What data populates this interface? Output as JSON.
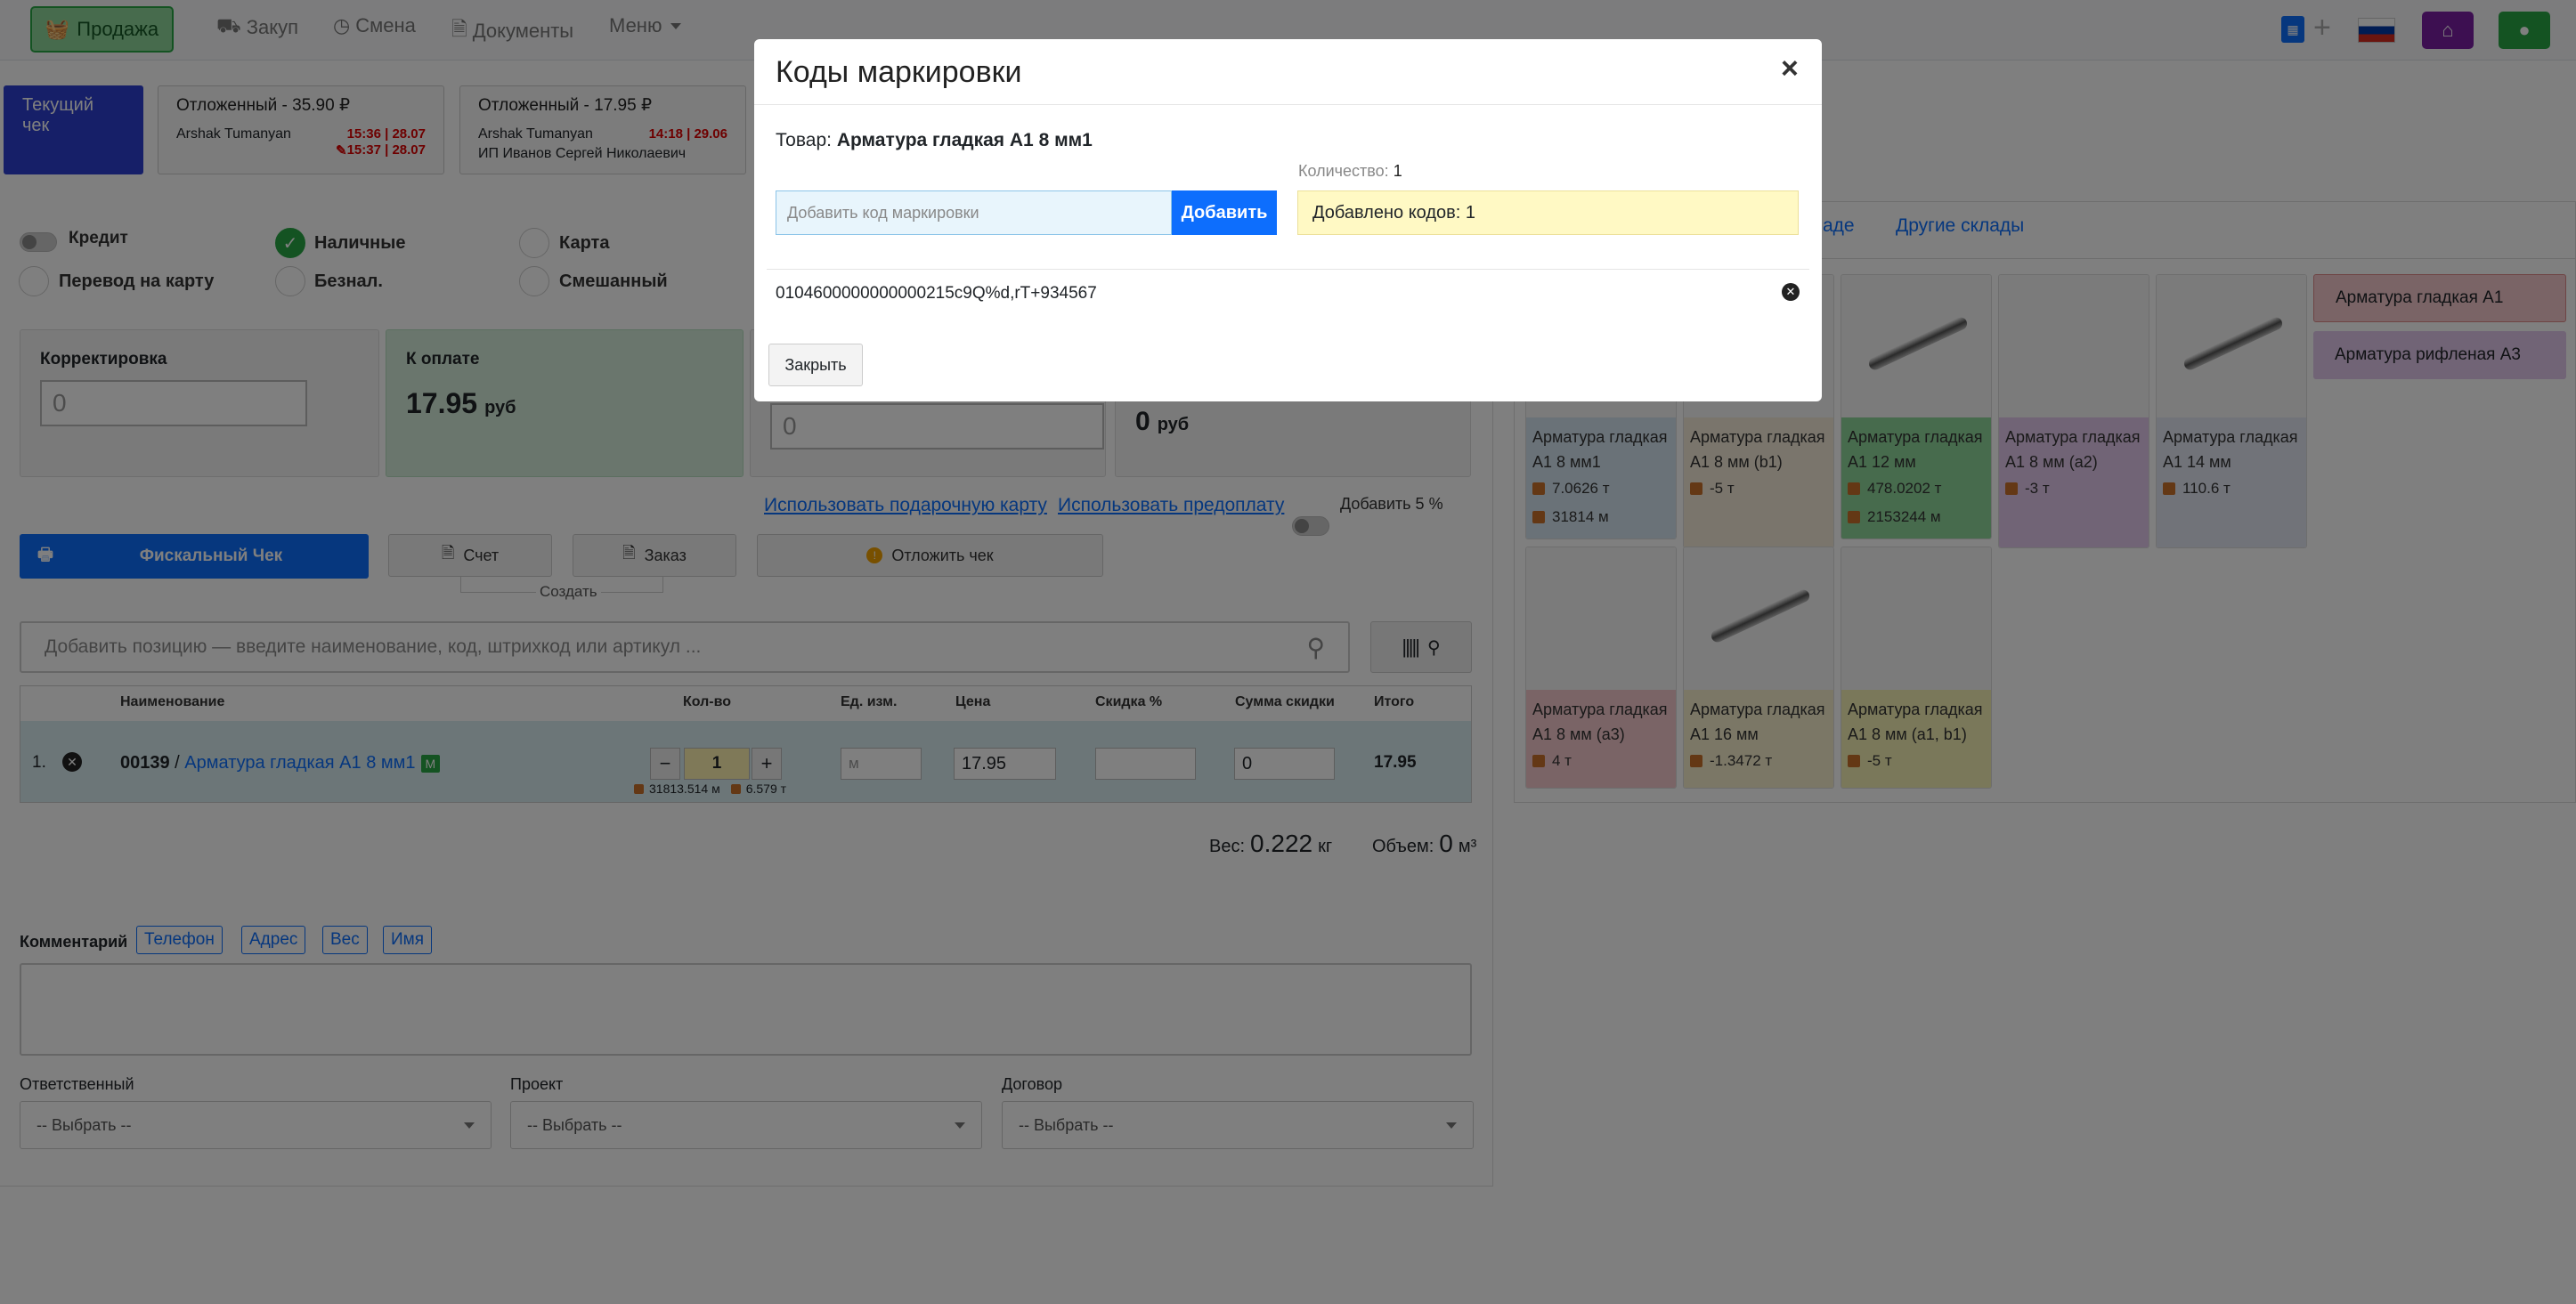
{
  "nav": {
    "sale": "Продажа",
    "purchase": "Закуп",
    "shift": "Смена",
    "documents": "Документы",
    "menu": "Меню"
  },
  "tabs": {
    "current": "Текущий чек",
    "deferred1": {
      "title": "Отложенный - 35.90 ₽",
      "user": "Arshak Tumanyan",
      "time1": "15:36 | 28.07",
      "time2": "15:37 | 28.07"
    },
    "deferred2": {
      "title": "Отложенный - 17.95 ₽",
      "user": "Arshak Tumanyan",
      "time1": "14:18 | 29.06",
      "client": "ИП Иванов Сергей Николаевич"
    }
  },
  "payment": {
    "credit": "Кредит",
    "cash": "Наличные",
    "card": "Карта",
    "transfer": "Перевод на карту",
    "cashless": "Безнал.",
    "mixed": "Смешанный"
  },
  "boxes": {
    "correction_label": "Корректировка",
    "correction_value": "0",
    "topay_label": "К оплате",
    "topay_value": "17.95",
    "topay_unit": "руб",
    "third_value": "0",
    "fourth_value": "0",
    "fourth_unit": "руб"
  },
  "links": {
    "gift": "Использовать подарочную карту",
    "prepay": "Использовать предоплату",
    "add5": "Добавить 5 %"
  },
  "actions": {
    "fiscal": "Фискальный Чек",
    "invoice": "Счет",
    "order": "Заказ",
    "defer": "Отложить чек",
    "create": "Создать"
  },
  "search": {
    "placeholder": "Добавить позицию — введите наименование, код, штрихкод или артикул ..."
  },
  "table": {
    "headers": [
      "Наименование",
      "Кол-во",
      "Ед. изм.",
      "Цена",
      "Скидка %",
      "Сумма скидки",
      "Итого"
    ],
    "row": {
      "num": "1.",
      "code": "00139",
      "sep": " / ",
      "name": "Арматура гладкая А1 8 мм1",
      "badge": "M",
      "qty": "1",
      "stock1": "31813.514 м",
      "stock2": "6.579 т",
      "unit": "м",
      "price": "17.95",
      "discount": "",
      "discount_sum": "0",
      "total": "17.95"
    }
  },
  "totals": {
    "weight_label": "Вес:",
    "weight_value": "0.222",
    "weight_unit": "кг",
    "volume_label": "Объем:",
    "volume_value": "0",
    "volume_unit": "м³"
  },
  "comment": {
    "label": "Комментарий",
    "tags": [
      "Телефон",
      "Адрес",
      "Вес",
      "Имя"
    ]
  },
  "selects": {
    "responsible": "Ответственный",
    "project": "Проект",
    "contract": "Договор",
    "placeholder": "-- Выбрать --"
  },
  "right": {
    "tab_partial": "аде",
    "tab_other": "Другие склады",
    "categories": [
      "Арматура гладкая А1",
      "Арматура рифленая А3"
    ],
    "products": [
      {
        "name": "Арматура гладкая А1 8 мм1",
        "s1": "7.0626 т",
        "s2": "31814 м",
        "color": "#d5e5f0"
      },
      {
        "name": "Арматура гладкая А1 8 мм (b1)",
        "s1": "-5 т",
        "s2": "",
        "color": "#f5ebd8"
      },
      {
        "name": "Арматура гладкая А1 12 мм",
        "s1": "478.0202 т",
        "s2": "2153244 м",
        "color": "#8fd69b"
      },
      {
        "name": "Арматура гладкая А1 8 мм (а2)",
        "s1": "-3 т",
        "s2": "",
        "color": "#e3c8ec"
      },
      {
        "name": "Арматура гладкая А1 14 мм",
        "s1": "110.6 т",
        "s2": "",
        "color": "#e2e6f3"
      },
      {
        "name": "Арматура гладкая А1 8 мм (а3)",
        "s1": "4 т",
        "s2": "",
        "color": "#f4c9cc"
      },
      {
        "name": "Арматура гладкая А1 16 мм",
        "s1": "-1.3472 т",
        "s2": "",
        "color": "#f6efcd"
      },
      {
        "name": "Арматура гладкая А1 8 мм (а1, b1)",
        "s1": "-5 т",
        "s2": "",
        "color": "#f4f0b5"
      }
    ]
  },
  "modal": {
    "title": "Коды маркировки",
    "close": "×",
    "product_label": "Товар:",
    "product_name": "Арматура гладкая А1 8 мм1",
    "qty_label": "Количество:",
    "qty_value": "1",
    "code_placeholder": "Добавить код маркировки",
    "add": "Добавить",
    "added": "Добавлено кодов: 1",
    "code": "0104600000000000215c9Q%d,rT+934567",
    "close_btn": "Закрыть"
  }
}
